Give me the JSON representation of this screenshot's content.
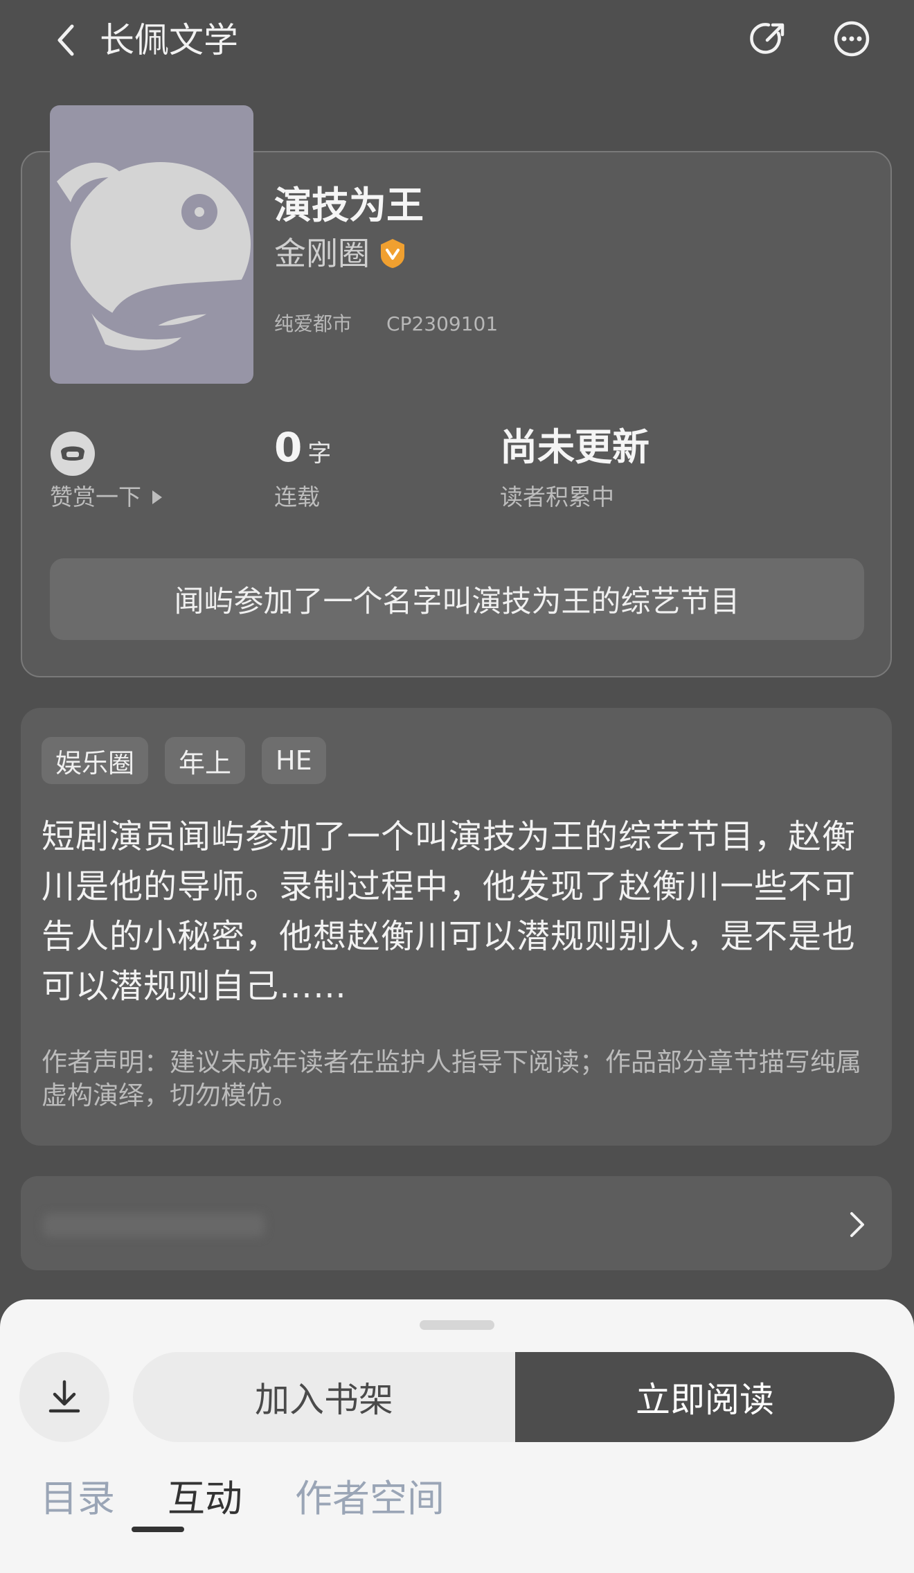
{
  "header": {
    "title": "长佩文学",
    "back_icon": "chevron-left-icon",
    "share_icon": "share-icon",
    "more_icon": "more-icon"
  },
  "book": {
    "title": "演技为王",
    "author": "金刚圈",
    "category": "纯爱都市",
    "id": "CP2309101",
    "tip_label": "赞赏一下",
    "word_count": "0",
    "word_unit": "字",
    "status": "连载",
    "update_text": "尚未更新",
    "update_sub": "读者积累中",
    "tagline": "闻屿参加了一个名字叫演技为王的综艺节目"
  },
  "intro": {
    "tags": [
      "娱乐圈",
      "年上",
      "HE"
    ],
    "synopsis": "短剧演员闻屿参加了一个叫演技为王的综艺节目，赵衡川是他的导师。录制过程中，他发现了赵衡川一些不可告人的小秘密，他想赵衡川可以潜规则别人，是不是也可以潜规则自己……",
    "statement": "作者声明：建议未成年读者在监护人指导下阅读；作品部分章节描写纯属虚构演绎，切勿模仿。"
  },
  "actions": {
    "add_shelf": "加入书架",
    "read_now": "立即阅读"
  },
  "tabs": [
    {
      "label": "目录",
      "active": false
    },
    {
      "label": "互动",
      "active": true
    },
    {
      "label": "作者空间",
      "active": false
    }
  ],
  "colors": {
    "background": "#4f4f4f",
    "card": "#5a5a5a",
    "verified": "#f0a030",
    "cover": "#9795a6",
    "read_button": "#4d4d4d"
  }
}
